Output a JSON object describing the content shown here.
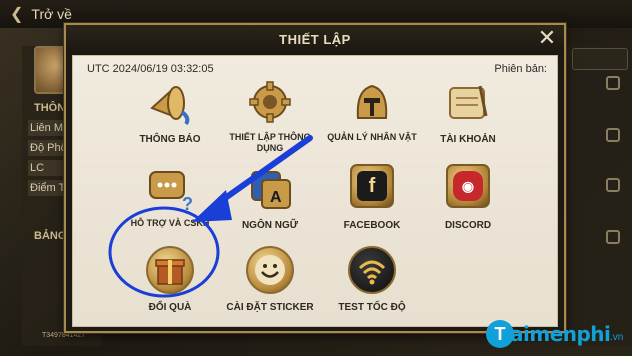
{
  "topbar": {
    "back_label": "Trở về"
  },
  "left_panel": {
    "section_label_1": "THÔN",
    "rows": [
      "Liên M",
      "Độ Phổ",
      "LC",
      "Điểm T"
    ],
    "section_label_2": "BẢNG",
    "player_code": "T3497841427"
  },
  "dialog": {
    "title": "THIẾT LẬP",
    "utc_time": "UTC  2024/06/19 03:32:05",
    "version_label": "Phiên bản:",
    "tiles": [
      {
        "label": "THÔNG BÁO"
      },
      {
        "label": "THIẾT LẬP THÔNG DỤNG"
      },
      {
        "label": "QUẢN LÝ NHÂN VẬT"
      },
      {
        "label": "TÀI KHOẢN"
      },
      {
        "label": "HỖ TRỢ VÀ CSKH"
      },
      {
        "label": "NGÔN NGỮ"
      },
      {
        "label": "FACEBOOK"
      },
      {
        "label": "DISCORD"
      },
      {
        "label": "ĐỔI QUÀ"
      },
      {
        "label": "CÀI ĐẶT STICKER"
      },
      {
        "label": "TEST TỐC ĐỘ"
      }
    ]
  },
  "annotation": {
    "color": "#1a3fd6"
  },
  "watermark": {
    "text": "aimenphi",
    "tld": ".vn",
    "color": "#12a0d8"
  }
}
